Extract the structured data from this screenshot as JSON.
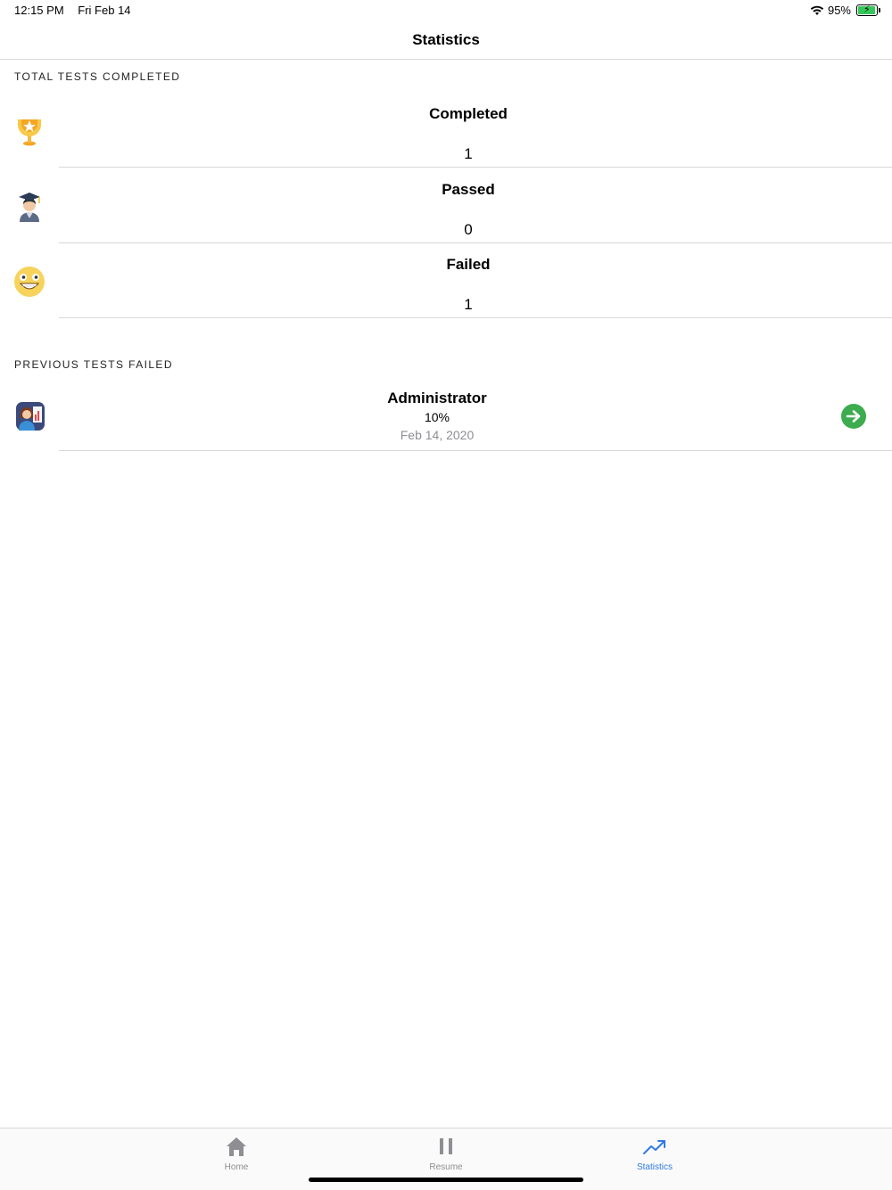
{
  "status_bar": {
    "time": "12:15 PM",
    "date": "Fri Feb 14",
    "battery": "95%",
    "icons": [
      "wifi-icon",
      "battery-charging-icon"
    ]
  },
  "nav": {
    "title": "Statistics"
  },
  "sections": {
    "total_header": "TOTAL TESTS COMPLETED",
    "failed_header": "PREVIOUS TESTS FAILED"
  },
  "stats": [
    {
      "title": "Completed",
      "value": "1",
      "icon": "trophy-icon"
    },
    {
      "title": "Passed",
      "value": "0",
      "icon": "graduate-icon"
    },
    {
      "title": "Failed",
      "value": "1",
      "icon": "grinning-face-icon"
    }
  ],
  "failed_tests": [
    {
      "title": "Administrator",
      "percent": "10%",
      "date": "Feb 14, 2020",
      "icon": "presenter-avatar-icon",
      "action_icon": "arrow-right-circle-icon"
    }
  ],
  "tab_bar": {
    "items": [
      {
        "label": "Home",
        "icon": "home-icon",
        "active": false
      },
      {
        "label": "Resume",
        "icon": "pause-icon",
        "active": false
      },
      {
        "label": "Statistics",
        "icon": "trending-up-icon",
        "active": true
      }
    ]
  },
  "colors": {
    "accent": "#2f7be5",
    "arrow_button": "#3cac4f",
    "divider": "#d8d8d8",
    "secondary_text": "#8e8e93"
  }
}
